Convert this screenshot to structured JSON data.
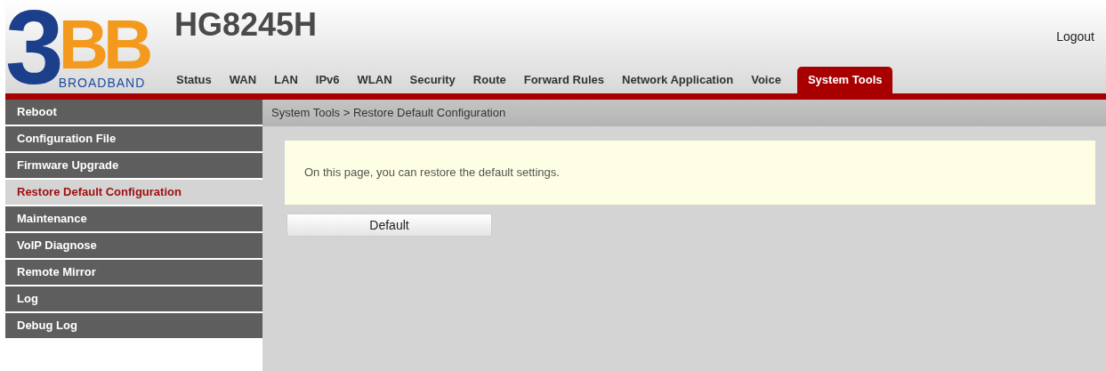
{
  "logo": {
    "digit": "3",
    "letters": "BB",
    "tagline": "BROADBAND"
  },
  "model": "HG8245H",
  "logout": "Logout",
  "tabs": [
    {
      "label": "Status",
      "selected": false
    },
    {
      "label": "WAN",
      "selected": false
    },
    {
      "label": "LAN",
      "selected": false
    },
    {
      "label": "IPv6",
      "selected": false
    },
    {
      "label": "WLAN",
      "selected": false
    },
    {
      "label": "Security",
      "selected": false
    },
    {
      "label": "Route",
      "selected": false
    },
    {
      "label": "Forward Rules",
      "selected": false
    },
    {
      "label": "Network Application",
      "selected": false
    },
    {
      "label": "Voice",
      "selected": false
    },
    {
      "label": "System Tools",
      "selected": true
    }
  ],
  "sidebar": {
    "items": [
      {
        "label": "Reboot",
        "selected": false
      },
      {
        "label": "Configuration File",
        "selected": false
      },
      {
        "label": "Firmware Upgrade",
        "selected": false
      },
      {
        "label": "Restore Default Configuration",
        "selected": true
      },
      {
        "label": "Maintenance",
        "selected": false
      },
      {
        "label": "VoIP Diagnose",
        "selected": false
      },
      {
        "label": "Remote Mirror",
        "selected": false
      },
      {
        "label": "Log",
        "selected": false
      },
      {
        "label": "Debug Log",
        "selected": false
      }
    ]
  },
  "breadcrumb": "System Tools > Restore Default Configuration",
  "notice": "On this page, you can restore the default settings.",
  "default_button": "Default"
}
